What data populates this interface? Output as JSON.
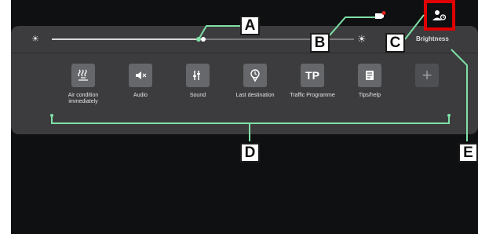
{
  "panel": {
    "brightness_level": 0.5,
    "brightness_label": "Brightness",
    "sun_left_icon": "sun-small-icon",
    "sun_right_icon": "sun-large-icon"
  },
  "status": {
    "notification_icon": "notification-icon",
    "user_icon": "user-profile-icon"
  },
  "tiles": [
    {
      "icon": "air-condition-icon",
      "label": "Air condition immediately"
    },
    {
      "icon": "mute-icon",
      "label": "Audio"
    },
    {
      "icon": "sound-settings-icon",
      "label": "Sound"
    },
    {
      "icon": "last-destination-icon",
      "label": "Last destination"
    },
    {
      "icon": "traffic-programme-icon",
      "text": "TP",
      "label": "Traffic Programme"
    },
    {
      "icon": "tips-help-icon",
      "label": "Tips/help"
    },
    {
      "icon": "add-icon",
      "text": "+",
      "label": ""
    }
  ],
  "callouts": {
    "a": "A",
    "b": "B",
    "c": "C",
    "d": "D",
    "e": "E"
  },
  "colors": {
    "panel": "#3c3c3e",
    "tile": "#66676a",
    "callout_line": "#7fe0a6",
    "highlight": "#e00000",
    "notification_dot": "#e02020"
  }
}
